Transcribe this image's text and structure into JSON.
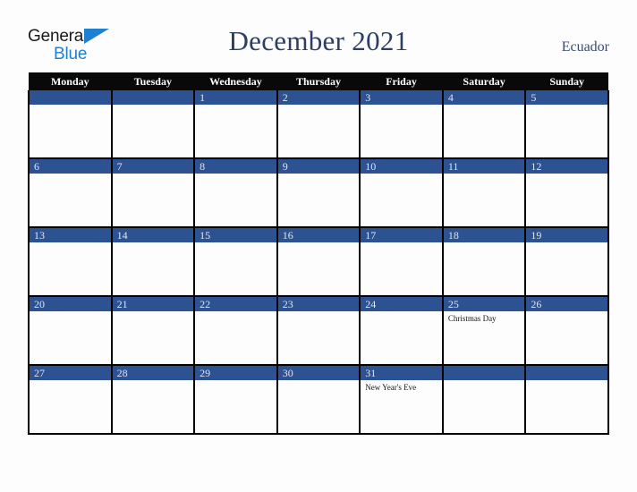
{
  "brand": {
    "name_part1": "General",
    "name_part2": "Blue",
    "triangle_icon": "blue-triangle-icon",
    "accent_color": "#1f7fd0",
    "text_color": "#1a1a1a"
  },
  "header": {
    "title": "December 2021",
    "country": "Ecuador",
    "title_color": "#2c3e63"
  },
  "calendar": {
    "weekday_headers": [
      "Monday",
      "Tuesday",
      "Wednesday",
      "Thursday",
      "Friday",
      "Saturday",
      "Sunday"
    ],
    "header_background": "#090909",
    "daynum_background": "#2d5292",
    "daynum_color": "#dfe5f0",
    "cell_background": "#fdfdfd",
    "border_color": "#000000",
    "weeks": [
      [
        {
          "day": "",
          "event": ""
        },
        {
          "day": "",
          "event": ""
        },
        {
          "day": "1",
          "event": ""
        },
        {
          "day": "2",
          "event": ""
        },
        {
          "day": "3",
          "event": ""
        },
        {
          "day": "4",
          "event": ""
        },
        {
          "day": "5",
          "event": ""
        }
      ],
      [
        {
          "day": "6",
          "event": ""
        },
        {
          "day": "7",
          "event": ""
        },
        {
          "day": "8",
          "event": ""
        },
        {
          "day": "9",
          "event": ""
        },
        {
          "day": "10",
          "event": ""
        },
        {
          "day": "11",
          "event": ""
        },
        {
          "day": "12",
          "event": ""
        }
      ],
      [
        {
          "day": "13",
          "event": ""
        },
        {
          "day": "14",
          "event": ""
        },
        {
          "day": "15",
          "event": ""
        },
        {
          "day": "16",
          "event": ""
        },
        {
          "day": "17",
          "event": ""
        },
        {
          "day": "18",
          "event": ""
        },
        {
          "day": "19",
          "event": ""
        }
      ],
      [
        {
          "day": "20",
          "event": ""
        },
        {
          "day": "21",
          "event": ""
        },
        {
          "day": "22",
          "event": ""
        },
        {
          "day": "23",
          "event": ""
        },
        {
          "day": "24",
          "event": ""
        },
        {
          "day": "25",
          "event": "Christmas Day"
        },
        {
          "day": "26",
          "event": ""
        }
      ],
      [
        {
          "day": "27",
          "event": ""
        },
        {
          "day": "28",
          "event": ""
        },
        {
          "day": "29",
          "event": ""
        },
        {
          "day": "30",
          "event": ""
        },
        {
          "day": "31",
          "event": "New Year's Eve"
        },
        {
          "day": "",
          "event": ""
        },
        {
          "day": "",
          "event": ""
        }
      ]
    ]
  }
}
